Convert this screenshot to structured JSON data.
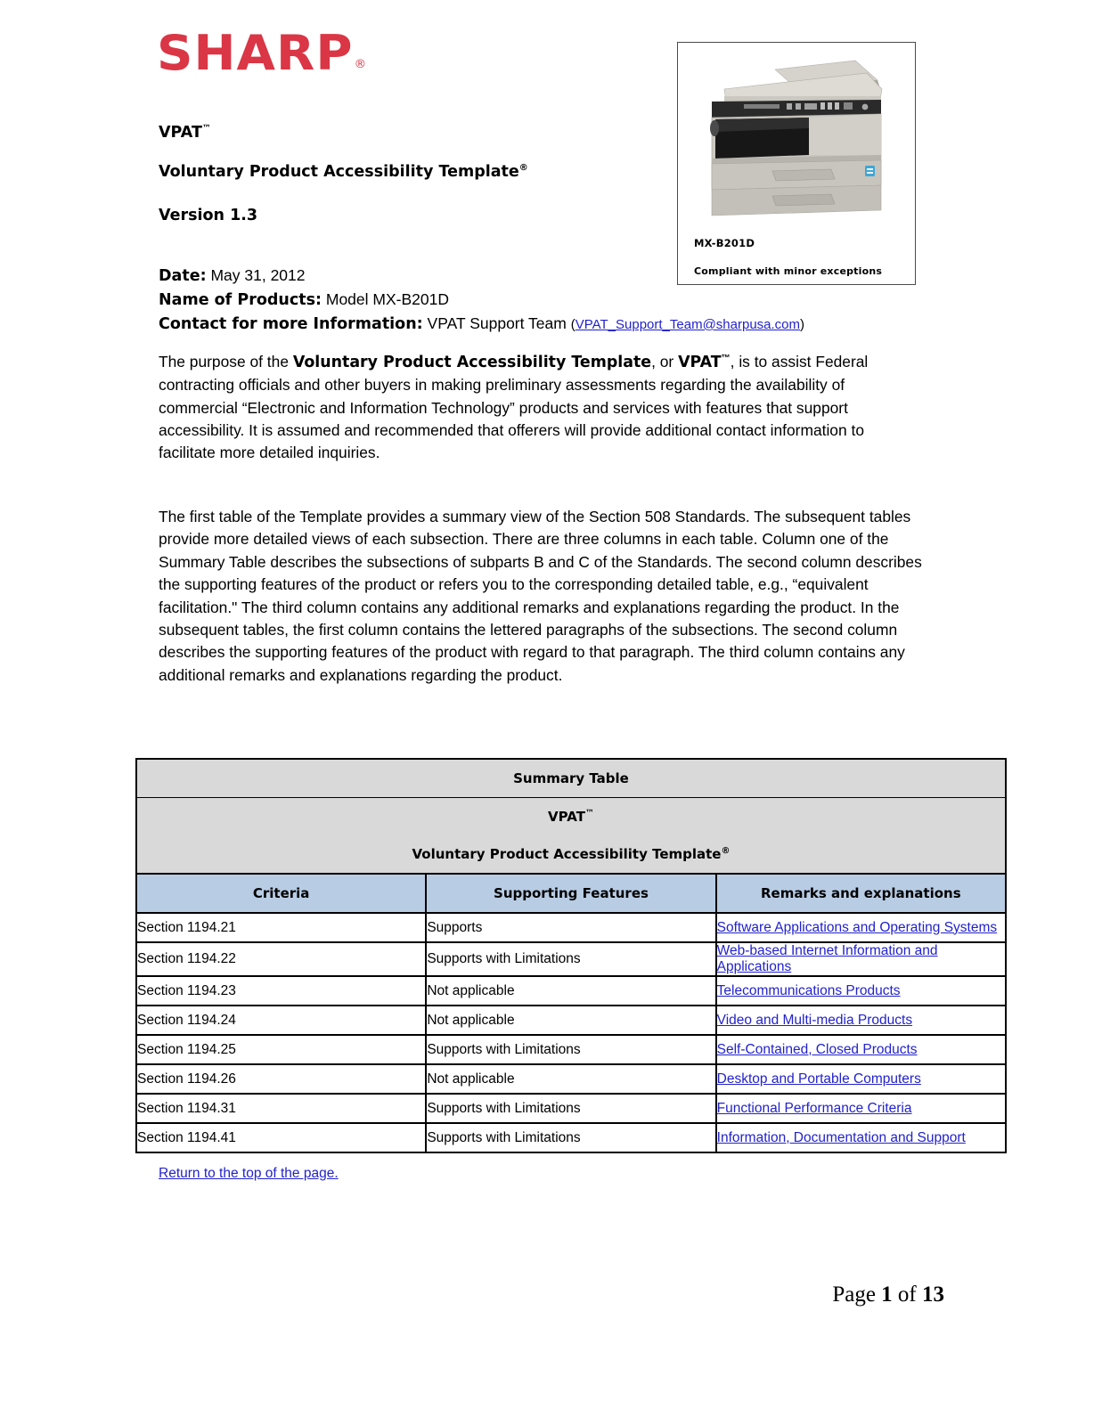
{
  "brand": {
    "name": "SHARP",
    "registered_mark": "®",
    "color": "#da3645"
  },
  "product_box": {
    "model": "MX-B201D",
    "compliance": "Compliant with minor exceptions",
    "image_alt": "MX-B201D multifunction printer"
  },
  "header": {
    "title_line1": "VPAT",
    "title_line1_mark": "™",
    "title_line2": "Voluntary Product Accessibility Template",
    "title_line2_mark": "®",
    "version": "Version 1.3"
  },
  "meta": {
    "date_label": "Date:",
    "date_value": "May 31, 2012",
    "products_label": "Name of Products:",
    "products_value": "Model MX-B201D",
    "contact_label": "Contact for more Information:",
    "contact_value": "VPAT Support Team",
    "contact_email": "VPAT_Support_Team@sharpusa.com",
    "paren_open": "(",
    "paren_close": ")"
  },
  "paragraphs": {
    "p1_a": "The purpose of the ",
    "p1_bold1": "Voluntary Product Accessibility Template",
    "p1_b": ", or ",
    "p1_bold2": "VPAT",
    "p1_mark": "™",
    "p1_c": ", is to assist Federal contracting officials and other buyers in making preliminary assessments regarding the availability of commercial “Electronic and Information Technology” products and services with features that support accessibility.  It is assumed and recommended that offerers will provide additional contact information to facilitate more detailed inquiries.",
    "p2": "The first table of the Template provides a summary view of the Section 508 Standards.  The subsequent tables provide more detailed views of each subsection.  There are three columns in each table.  Column one of the Summary Table describes the subsections of subparts B and C of the Standards.  The second column describes the supporting features of the product or refers you to the corresponding detailed table, e.g., “equivalent facilitation.\"  The third column contains any additional remarks and explanations regarding the product.  In the subsequent tables, the first column contains the lettered paragraphs of the subsections.  The second column describes the supporting features of the product with regard to that paragraph.  The third column contains any additional remarks and explanations regarding the product."
  },
  "summary_table": {
    "title_line1": "Summary Table",
    "title_line2": "VPAT",
    "title_line2_mark": "™",
    "title_line3": "Voluntary Product Accessibility Template",
    "title_line3_mark": "®",
    "columns": [
      "Criteria",
      "Supporting Features",
      "Remarks and explanations"
    ],
    "rows": [
      {
        "criteria": "Section 1194.21",
        "supporting": "Supports",
        "remarks": "Software Applications and Operating Systems"
      },
      {
        "criteria": "Section 1194.22",
        "supporting": "Supports with Limitations",
        "remarks": "Web-based Internet Information and Applications"
      },
      {
        "criteria": "Section 1194.23",
        "supporting": "Not applicable",
        "remarks": "Telecommunications Products"
      },
      {
        "criteria": "Section 1194.24",
        "supporting": "Not applicable",
        "remarks": "Video and Multi-media Products"
      },
      {
        "criteria": "Section 1194.25",
        "supporting": "Supports with Limitations",
        "remarks": "Self-Contained, Closed Products"
      },
      {
        "criteria": "Section 1194.26",
        "supporting": "Not applicable",
        "remarks": "Desktop and Portable Computers"
      },
      {
        "criteria": "Section 1194.31",
        "supporting": "Supports with Limitations",
        "remarks": "Functional Performance Criteria"
      },
      {
        "criteria": "Section 1194.41",
        "supporting": "Supports with Limitations",
        "remarks": "Information, Documentation and Support"
      }
    ]
  },
  "return_link": "Return to the top of the page.",
  "footer": {
    "prefix": "Page ",
    "page_number": "1",
    "middle": " of ",
    "total_pages": "13"
  },
  "colors": {
    "link": "#2222cc",
    "table_title_bg": "#d9d9d9",
    "table_header_bg": "#b8cce4",
    "brand_red": "#da3645"
  }
}
